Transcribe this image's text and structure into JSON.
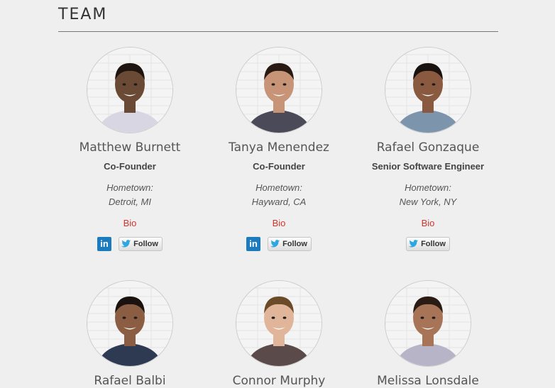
{
  "section": {
    "title": "TEAM"
  },
  "members": [
    {
      "name": "Matthew Burnett",
      "role": "Co-Founder",
      "hometown_label": "Hometown:",
      "hometown": "Detroit, MI",
      "bio_label": "Bio",
      "linkedin_label": "in",
      "follow_label": "Follow",
      "skin": "#6b4a35",
      "hair": "#1e1510",
      "shirt": "#d9d6e3"
    },
    {
      "name": "Tanya Menendez",
      "role": "Co-Founder",
      "hometown_label": "Hometown:",
      "hometown": "Hayward, CA",
      "bio_label": "Bio",
      "linkedin_label": "in",
      "follow_label": "Follow",
      "skin": "#c79478",
      "hair": "#2a1a14",
      "shirt": "#4a4a58"
    },
    {
      "name": "Rafael Gonzaque",
      "role": "Senior Software Engineer",
      "hometown_label": "Hometown:",
      "hometown": "New York, NY",
      "bio_label": "Bio",
      "follow_label": "Follow",
      "skin": "#8a5a40",
      "hair": "#1a120e",
      "shirt": "#7d94ad"
    },
    {
      "name": "Rafael Balbi",
      "skin": "#8b5e44",
      "hair": "#1a120e",
      "shirt": "#2e3a52"
    },
    {
      "name": "Connor Murphy",
      "skin": "#e0b59a",
      "hair": "#6b4a2a",
      "shirt": "#5a4a4a"
    },
    {
      "name": "Melissa Lonsdale",
      "skin": "#a87458",
      "hair": "#2a1c14",
      "shirt": "#b8b4c8"
    }
  ],
  "colors": {
    "background": "#efefef",
    "bio_link": "#d0342c",
    "linkedin": "#1c7bbf",
    "twitter": "#2ea7e0"
  },
  "icons": {
    "linkedin": "linkedin-icon",
    "twitter": "twitter-bird-icon"
  }
}
